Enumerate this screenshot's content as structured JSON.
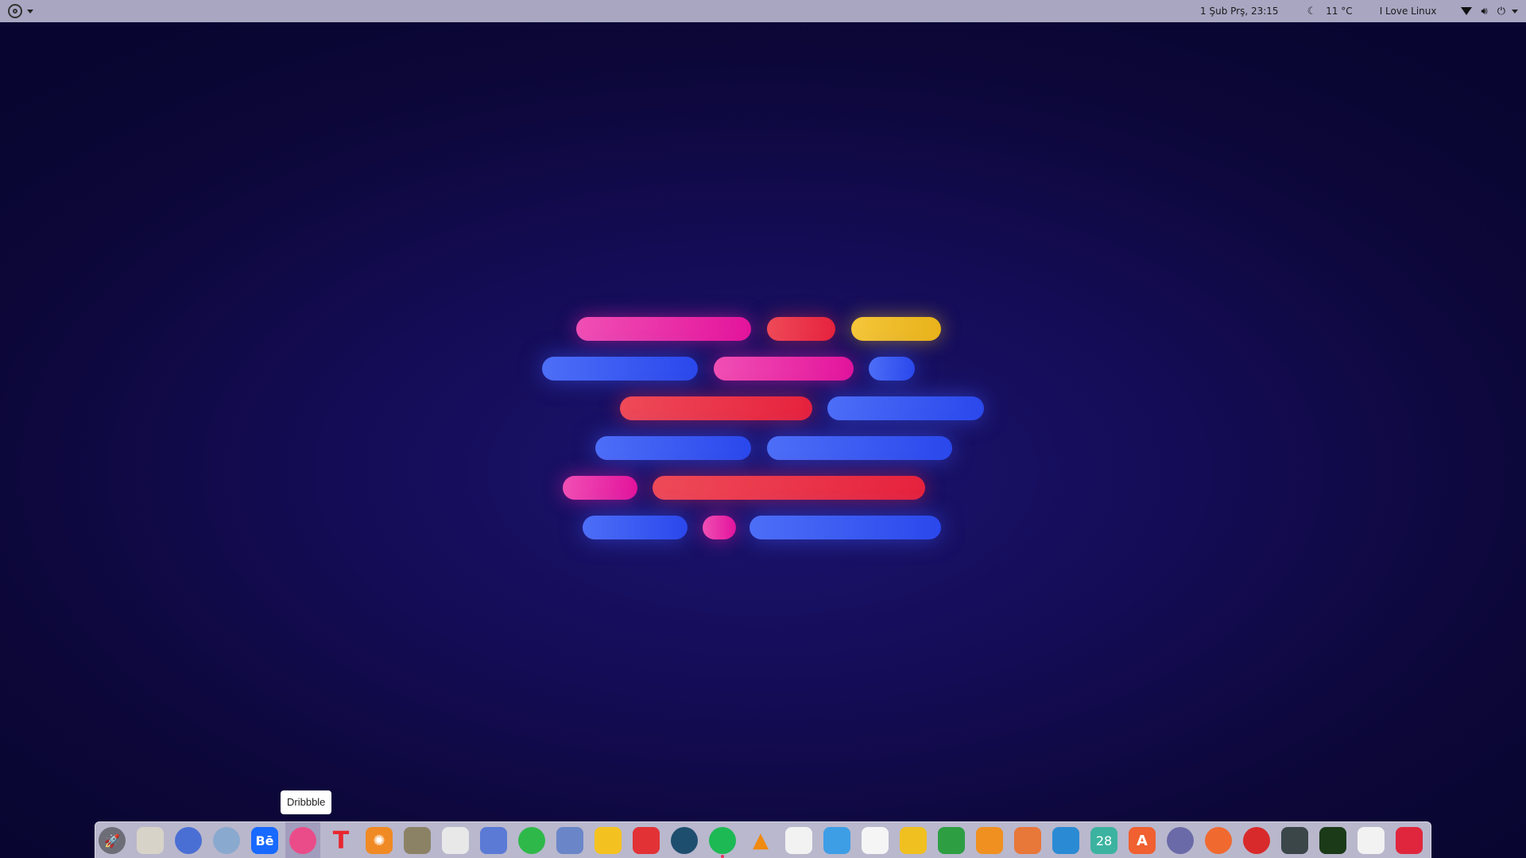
{
  "top_panel": {
    "datetime": "1 Şub Prş, 23:15",
    "temperature": "11 °C",
    "user": "I Love Linux",
    "icons": [
      "ubuntu-logo-icon",
      "weather-moon-icon",
      "wifi-icon",
      "volume-icon",
      "power-icon"
    ]
  },
  "tooltip": {
    "label": "Dribbble"
  },
  "dock": {
    "items": [
      {
        "name": "launcher-rocket-icon",
        "glyph": "🚀",
        "color": "#6d6d78"
      },
      {
        "name": "files-icon",
        "glyph": "",
        "color": "#d8d3c8"
      },
      {
        "name": "firefox-icon",
        "glyph": "",
        "color": "#4a6fd4"
      },
      {
        "name": "chromium-icon",
        "glyph": "",
        "color": "#8aa9cf"
      },
      {
        "name": "behance-icon",
        "glyph": "Bē",
        "color": "#1769ff"
      },
      {
        "name": "dribbble-icon",
        "glyph": "",
        "color": "#ea4c89"
      },
      {
        "name": "typora-icon",
        "glyph": "T",
        "color": "transparent"
      },
      {
        "name": "inkscape-icon",
        "glyph": "✺",
        "color": "#f08a24"
      },
      {
        "name": "gimp-icon",
        "glyph": "",
        "color": "#8b8266"
      },
      {
        "name": "camera-icon",
        "glyph": "",
        "color": "#e8e8e8"
      },
      {
        "name": "discord-icon",
        "glyph": "",
        "color": "#5a7ad6"
      },
      {
        "name": "whatsapp-icon",
        "glyph": "",
        "color": "#2fb84a"
      },
      {
        "name": "twitter-bird-icon",
        "glyph": "",
        "color": "#6a86c9"
      },
      {
        "name": "bulb-icon",
        "glyph": "",
        "color": "#f4c220"
      },
      {
        "name": "anydesk-icon",
        "glyph": "",
        "color": "#e23236"
      },
      {
        "name": "teamviewer-icon",
        "glyph": "",
        "color": "#1e4e6e"
      },
      {
        "name": "spotify-icon",
        "glyph": "",
        "color": "#1db954"
      },
      {
        "name": "vlc-icon",
        "glyph": "▲",
        "color": "transparent"
      },
      {
        "name": "clapper-icon",
        "glyph": "",
        "color": "#f2f2f2"
      },
      {
        "name": "headphones-icon",
        "glyph": "",
        "color": "#3d9ee6"
      },
      {
        "name": "screenshot-icon",
        "glyph": "",
        "color": "#f5f5f5"
      },
      {
        "name": "calculator-icon",
        "glyph": "",
        "color": "#f0c020"
      },
      {
        "name": "spreadsheet-icon",
        "glyph": "",
        "color": "#2e9e43"
      },
      {
        "name": "presentation-icon",
        "glyph": "",
        "color": "#f09020"
      },
      {
        "name": "document-icon",
        "glyph": "",
        "color": "#e8773a"
      },
      {
        "name": "writer-icon",
        "glyph": "",
        "color": "#2a8ad4"
      },
      {
        "name": "calendar-icon",
        "glyph": "28",
        "color": "#3bb3a0"
      },
      {
        "name": "app-store-icon",
        "glyph": "A",
        "color": "#f06030"
      },
      {
        "name": "settings-grid-icon",
        "glyph": "",
        "color": "#6a6aa8"
      },
      {
        "name": "update-icon",
        "glyph": "",
        "color": "#f06a30"
      },
      {
        "name": "speedometer-icon",
        "glyph": "",
        "color": "#d82a2a"
      },
      {
        "name": "terminal-icon",
        "glyph": "",
        "color": "#3a4648"
      },
      {
        "name": "system-monitor-icon",
        "glyph": "",
        "color": "#1a3a18"
      },
      {
        "name": "tweaks-icon",
        "glyph": "",
        "color": "#f2f2f2"
      },
      {
        "name": "power-settings-icon",
        "glyph": "",
        "color": "#e0263c"
      }
    ]
  }
}
